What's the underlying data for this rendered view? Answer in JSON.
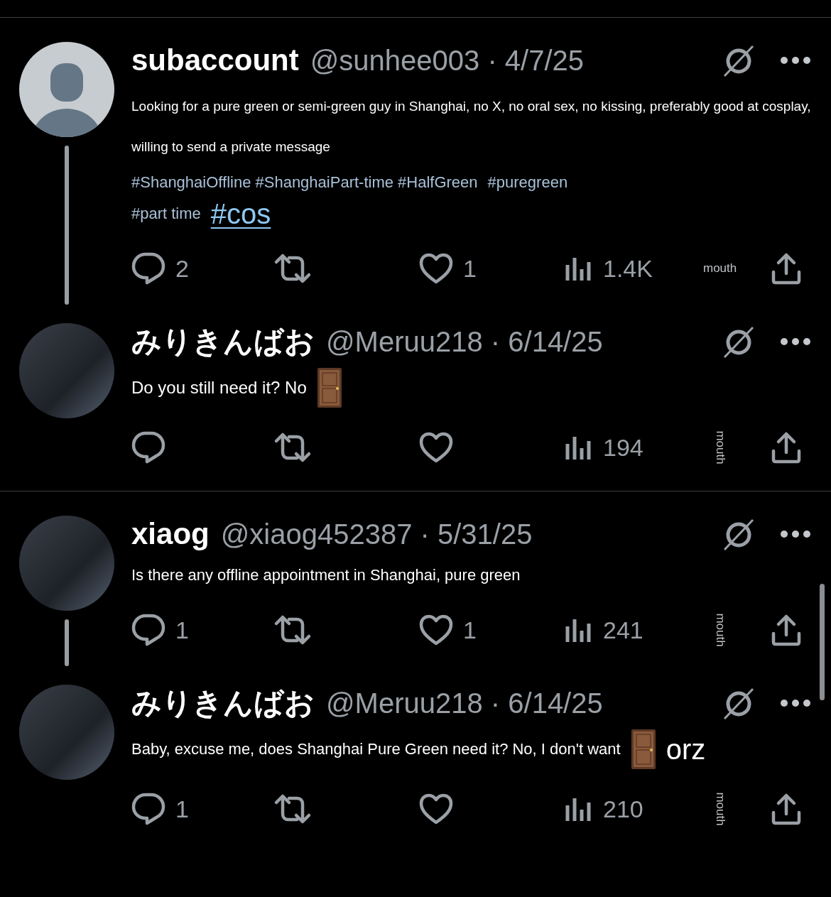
{
  "threads": [
    {
      "posts": [
        {
          "avatar": {
            "kind": "default"
          },
          "thread_line": true,
          "name": "subaccount",
          "meta": "@sunhee003 · 4/7/25",
          "body": [
            [
              {
                "kind": "small_text",
                "text": "Looking for a pure green or semi-green guy in Shanghai, no X, no oral sex, no kissing, preferably good at cosplay, willing to send a private message"
              }
            ],
            [
              {
                "kind": "tag",
                "text": "#ShanghaiOffline #ShanghaiPart-time #HalfGreen"
              },
              {
                "kind": "tag",
                "text": "#puregreen"
              }
            ],
            [
              {
                "kind": "tag",
                "text": "#part time"
              },
              {
                "kind": "link",
                "text": "#cos"
              }
            ]
          ],
          "replies": "2",
          "likes": "1",
          "views": "1.4K",
          "bookmark": {
            "text": "mouth",
            "rotated": false
          }
        },
        {
          "avatar": {
            "kind": "photo"
          },
          "thread_line": false,
          "name": "みりきんばお",
          "meta": "@Meruu218 · 6/14/25",
          "body": [
            [
              {
                "kind": "large_text",
                "text": "Do you still need it? No"
              },
              {
                "kind": "door"
              }
            ]
          ],
          "views": "194",
          "bookmark": {
            "text": "mouth",
            "rotated": true
          }
        }
      ]
    },
    {
      "posts": [
        {
          "avatar": {
            "kind": "photo"
          },
          "thread_line": true,
          "name": "xiaog",
          "meta": "@xiaog452387 · 5/31/25",
          "body": [
            [
              {
                "kind": "text",
                "text": "Is there any offline appointment in Shanghai, pure green"
              }
            ]
          ],
          "replies": "1",
          "likes": "1",
          "views": "241",
          "bookmark": {
            "text": "mouth",
            "rotated": true
          }
        },
        {
          "avatar": {
            "kind": "photo"
          },
          "thread_line": false,
          "name": "みりきんばお",
          "meta": "@Meruu218 · 6/14/25",
          "body": [
            [
              {
                "kind": "text",
                "text": "Baby, excuse me, does Shanghai Pure Green need it? No, I don't want"
              },
              {
                "kind": "door"
              },
              {
                "kind": "big",
                "text": "orz"
              }
            ]
          ],
          "replies": "1",
          "views": "210",
          "bookmark": {
            "text": "mouth",
            "rotated": true
          }
        }
      ]
    }
  ]
}
